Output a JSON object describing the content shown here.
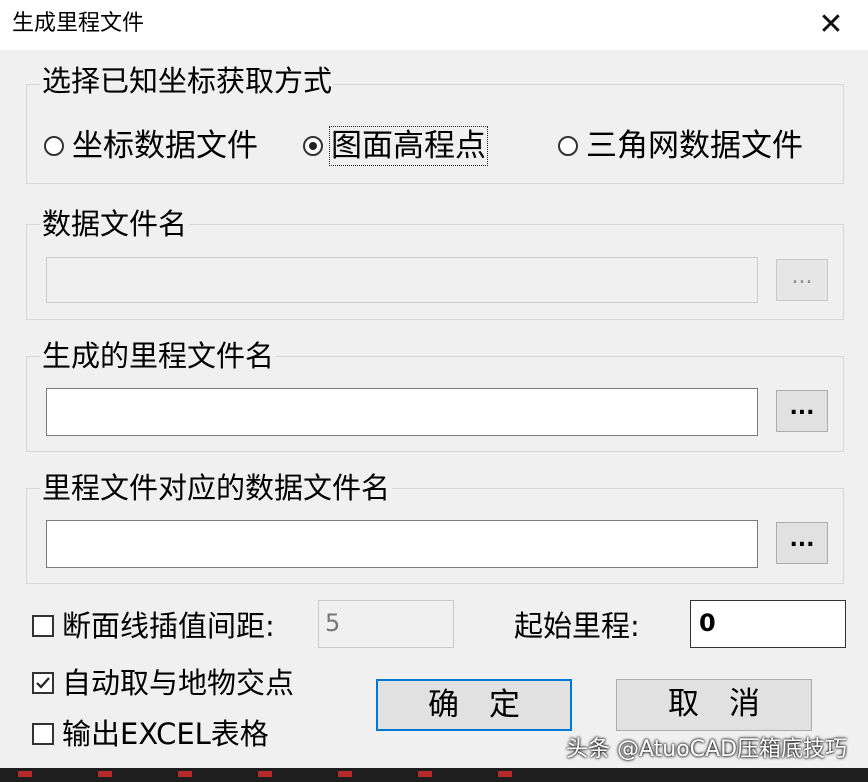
{
  "window": {
    "title": "生成里程文件",
    "close_glyph": "✕"
  },
  "mode_group": {
    "legend": "选择已知坐标获取方式",
    "options": [
      {
        "label": "坐标数据文件",
        "checked": false
      },
      {
        "label": "图面高程点",
        "checked": true
      },
      {
        "label": "三角网数据文件",
        "checked": false
      }
    ]
  },
  "data_file_group": {
    "legend": "数据文件名",
    "value": "",
    "browse_label": "..."
  },
  "mileage_file_group": {
    "legend": "生成的里程文件名",
    "value": "",
    "browse_label": "..."
  },
  "mapping_file_group": {
    "legend": "里程文件对应的数据文件名",
    "value": "",
    "browse_label": "..."
  },
  "interval": {
    "label": "断面线插值间距:",
    "checked": false,
    "value": "5"
  },
  "start_mileage": {
    "label": "起始里程:",
    "value": "0"
  },
  "auto_intersect": {
    "label": "自动取与地物交点",
    "checked": true
  },
  "export_excel": {
    "label": "输出EXCEL表格",
    "checked": false
  },
  "buttons": {
    "ok": "确定",
    "cancel": "取消"
  },
  "watermark": "头条 @AtuoCAD压箱底技巧",
  "icons": {
    "close": "close-icon",
    "check": "check-mark-icon"
  }
}
